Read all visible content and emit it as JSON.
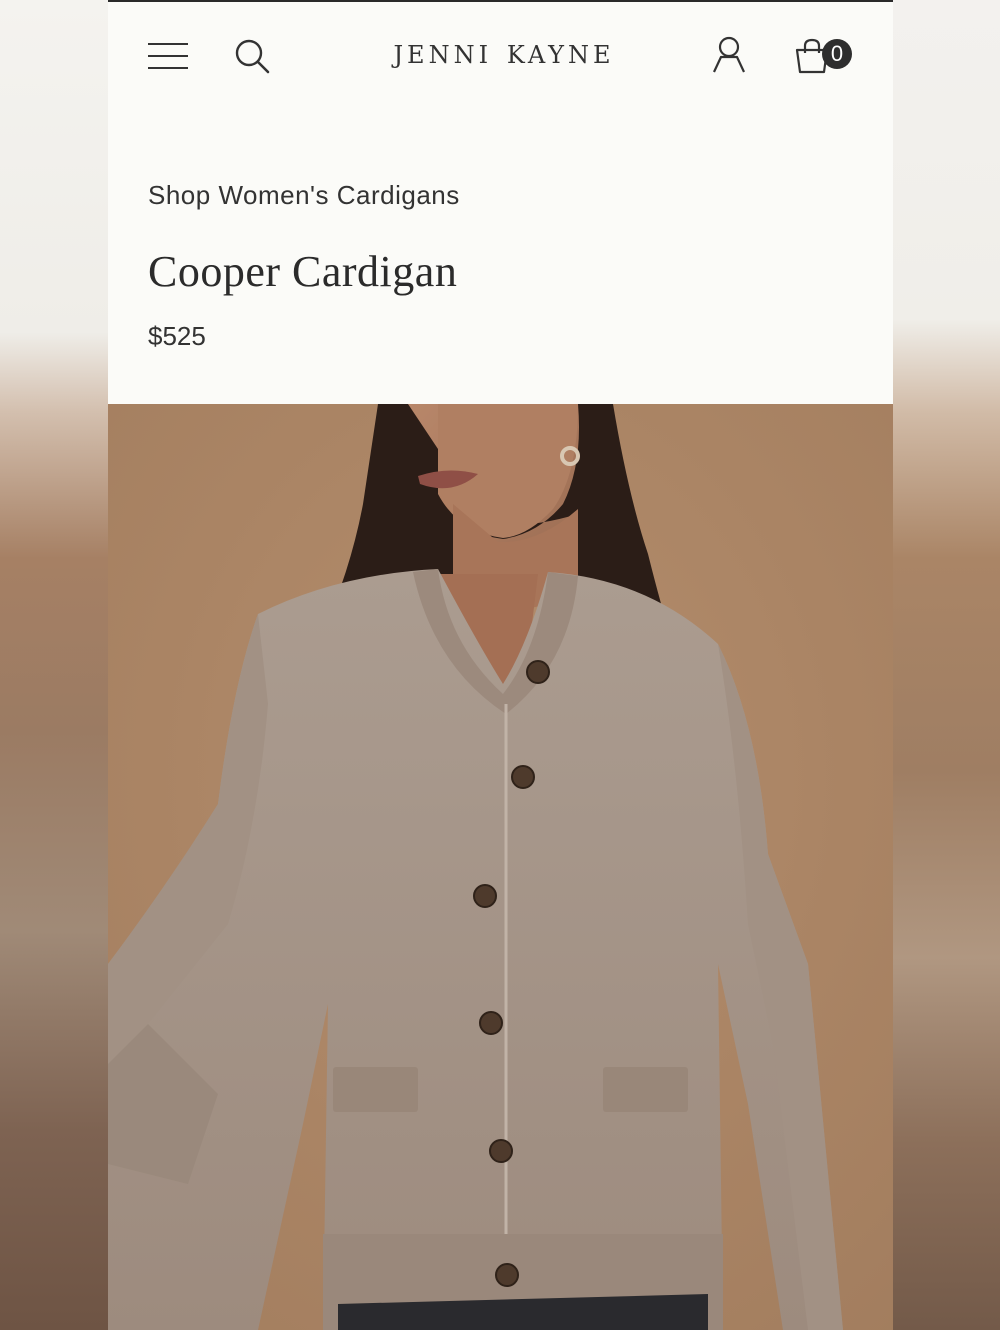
{
  "header": {
    "brand": "jenni kayne",
    "cart_count": "0",
    "icons": [
      "menu-icon",
      "search-icon",
      "account-icon",
      "cart-icon"
    ]
  },
  "product": {
    "breadcrumb": "Shop Women's Cardigans",
    "title": "Cooper Cardigan",
    "price": "$525"
  },
  "colors": {
    "background": "#fbfbf8",
    "text": "#333333",
    "image_backdrop": "#ad8665",
    "sweater": "#a8978a",
    "buttons": "#4e3a2c"
  }
}
